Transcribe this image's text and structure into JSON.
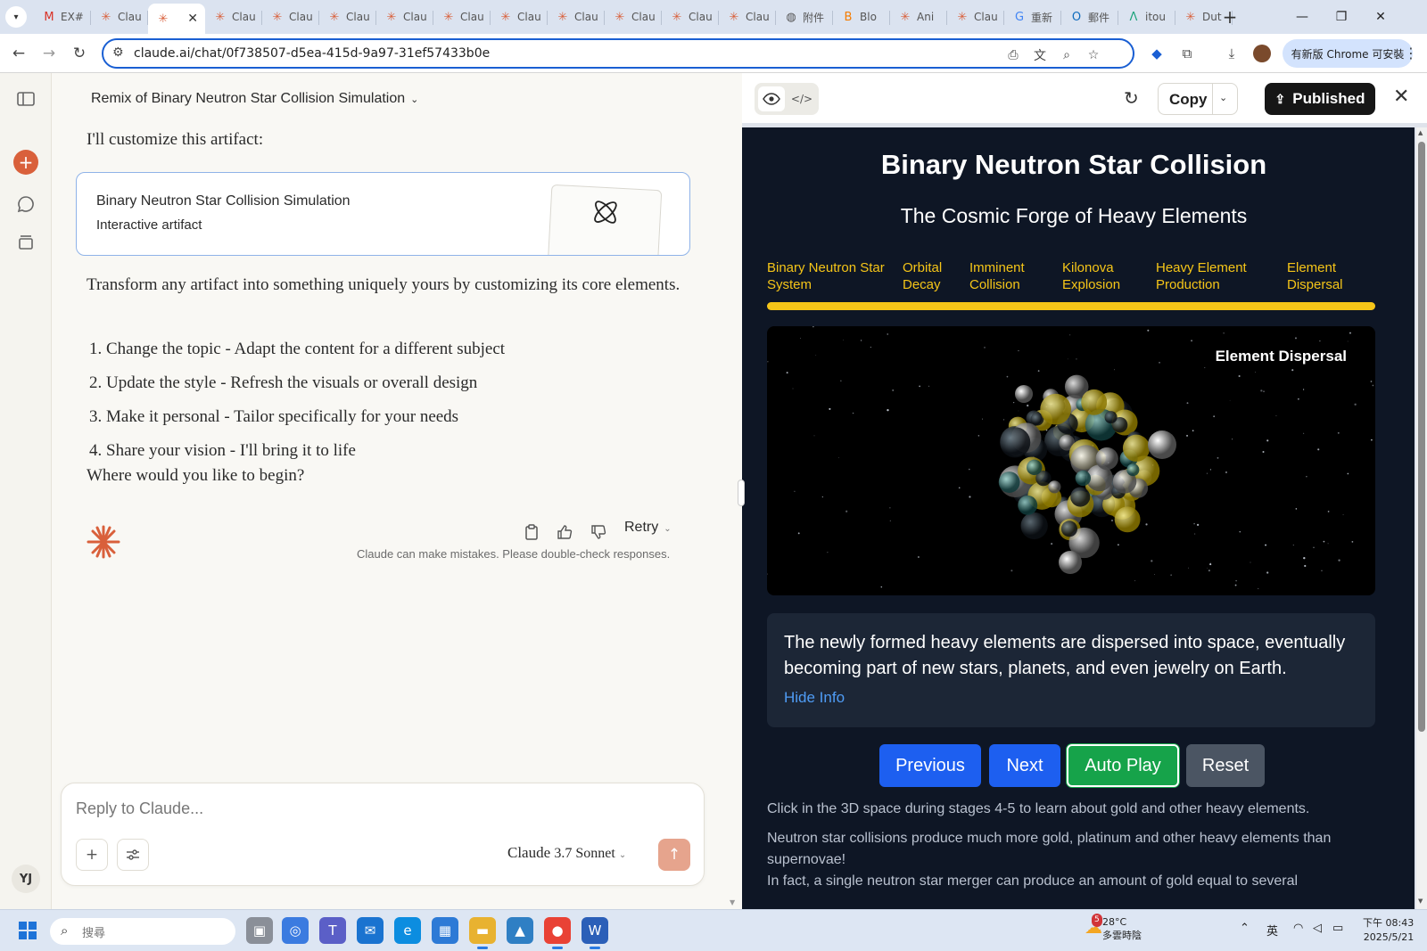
{
  "browser": {
    "tabs": [
      {
        "label": "EX#",
        "icon": "gmail-icon",
        "color": "#d93025",
        "glyph": "M"
      },
      {
        "label": "Clau",
        "icon": "claude-icon",
        "color": "#d9603b",
        "glyph": "✳"
      },
      {
        "label": "",
        "icon": "claude-icon",
        "color": "#d9603b",
        "glyph": "✳",
        "active": true
      },
      {
        "label": "Clau",
        "icon": "claude-icon",
        "color": "#d9603b",
        "glyph": "✳"
      },
      {
        "label": "Clau",
        "icon": "claude-icon",
        "color": "#d9603b",
        "glyph": "✳"
      },
      {
        "label": "Clau",
        "icon": "claude-icon",
        "color": "#d9603b",
        "glyph": "✳"
      },
      {
        "label": "Clau",
        "icon": "claude-icon",
        "color": "#d9603b",
        "glyph": "✳"
      },
      {
        "label": "Clau",
        "icon": "claude-icon",
        "color": "#d9603b",
        "glyph": "✳"
      },
      {
        "label": "Clau",
        "icon": "claude-icon",
        "color": "#d9603b",
        "glyph": "✳"
      },
      {
        "label": "Clau",
        "icon": "claude-icon",
        "color": "#d9603b",
        "glyph": "✳"
      },
      {
        "label": "Clau",
        "icon": "claude-icon",
        "color": "#d9603b",
        "glyph": "✳"
      },
      {
        "label": "Clau",
        "icon": "claude-icon",
        "color": "#d9603b",
        "glyph": "✳"
      },
      {
        "label": "Clau",
        "icon": "claude-icon",
        "color": "#d9603b",
        "glyph": "✳"
      },
      {
        "label": "附件",
        "icon": "globe-icon",
        "color": "#555555",
        "glyph": "◍"
      },
      {
        "label": "Blo",
        "icon": "blogger-icon",
        "color": "#f57c00",
        "glyph": "B"
      },
      {
        "label": "Ani",
        "icon": "claude-icon",
        "color": "#d9603b",
        "glyph": "✳"
      },
      {
        "label": "Clau",
        "icon": "claude-icon",
        "color": "#d9603b",
        "glyph": "✳"
      },
      {
        "label": "重新",
        "icon": "google-icon",
        "color": "#4285f4",
        "glyph": "G"
      },
      {
        "label": "郵件",
        "icon": "outlook-icon",
        "color": "#0f6cbd",
        "glyph": "O"
      },
      {
        "label": "itou",
        "icon": "app-icon",
        "color": "#1aa37a",
        "glyph": "Λ"
      },
      {
        "label": "Dut",
        "icon": "claude-icon",
        "color": "#d9603b",
        "glyph": "✳"
      }
    ],
    "url": "claude.ai/chat/0f738507-d5ea-415d-9a97-31ef57433b0e",
    "update_button": "有新版 Chrome 可安裝"
  },
  "chat": {
    "title": "Remix of Binary Neutron Star Collision Simulation",
    "intro": "I'll customize this artifact:",
    "artifact_card": {
      "title": "Binary Neutron Star Collision Simulation",
      "subtitle": "Interactive artifact"
    },
    "paragraph": "Transform any artifact into something uniquely yours by customizing its core elements.",
    "list": [
      "Change the topic - Adapt the content for a different subject",
      "Update the style - Refresh the visuals or overall design",
      "Make it personal - Tailor specifically for your needs",
      "Share your vision - I'll bring it to life"
    ],
    "question": "Where would you like to begin?",
    "retry": "Retry",
    "disclaimer": "Claude can make mistakes. Please double-check responses.",
    "composer_placeholder": "Reply to Claude...",
    "model_name": "Claude",
    "model_version": "3.7 Sonnet",
    "user_initials": "YJ",
    "brand_color": "#d9603b"
  },
  "artifact_panel": {
    "copy": "Copy",
    "publish": "Published",
    "title": "Binary Neutron Star Collision",
    "subtitle": "The Cosmic Forge of Heavy Elements",
    "stages": [
      [
        "Binary Neutron Star",
        "System"
      ],
      [
        "Orbital",
        "Decay"
      ],
      [
        "Imminent",
        "Collision"
      ],
      [
        "Kilonova",
        "Explosion"
      ],
      [
        "Heavy Element",
        "Production"
      ],
      [
        "Element",
        "Dispersal"
      ]
    ],
    "progress_fraction": 1.0,
    "stage_label": "Element Dispersal",
    "info_text": "The newly formed heavy elements are dispersed into space, eventually becoming part of new stars, planets, and even jewelry on Earth.",
    "hide_info": "Hide Info",
    "buttons": {
      "previous": "Previous",
      "next": "Next",
      "autoplay": "Auto Play",
      "reset": "Reset"
    },
    "note1": "Click in the 3D space during stages 4-5 to learn about gold and other heavy elements.",
    "note2": "Neutron star collisions produce much more gold, platinum and other heavy elements than supernovae!",
    "note3": "In fact, a single neutron star merger can produce an amount of gold equal to several",
    "accent_yellow": "#f5c518",
    "button_blue": "#1d5ff0",
    "button_green": "#16a34a",
    "button_gray": "#4b5563"
  },
  "taskbar": {
    "search_placeholder": "搜尋",
    "weather_badge": "5",
    "weather_temp": "28°C",
    "weather_desc": "多雲時陰",
    "ime": "英",
    "time": "下午 08:43",
    "date": "2025/5/21"
  }
}
